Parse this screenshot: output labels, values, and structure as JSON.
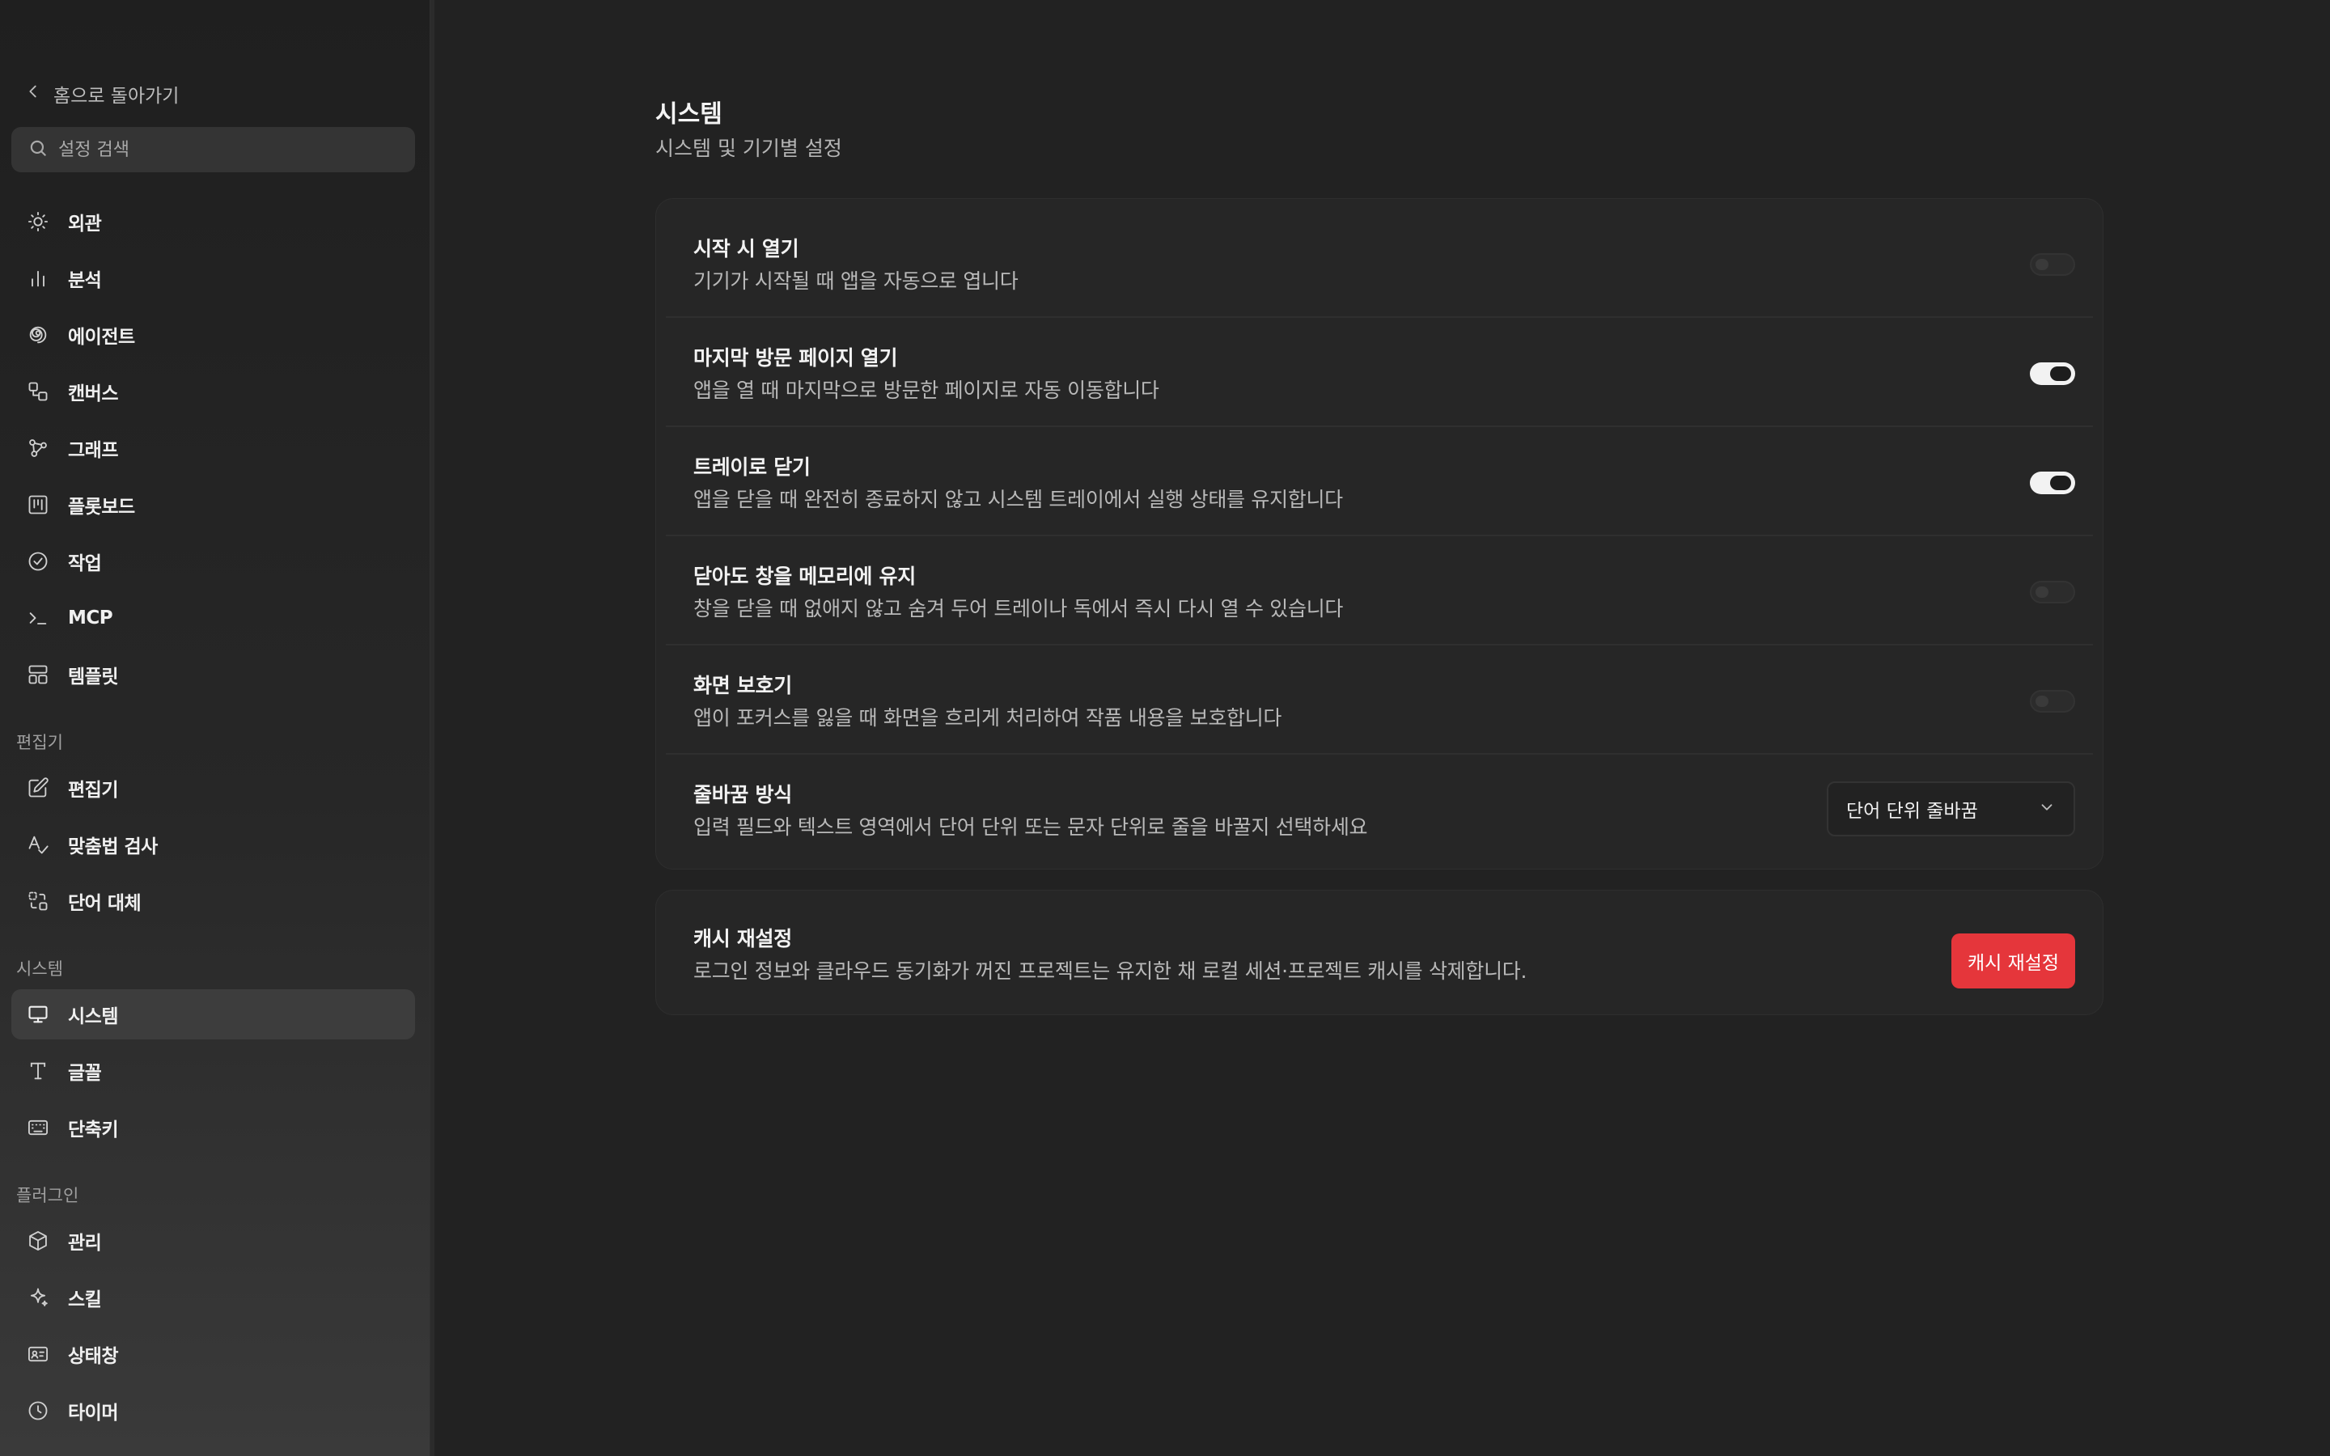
{
  "sidebar": {
    "back_label": "홈으로 돌아가기",
    "search_placeholder": "설정 검색",
    "general_items": [
      {
        "label": "외관",
        "icon": "sun-icon"
      },
      {
        "label": "분석",
        "icon": "bar-chart-icon"
      },
      {
        "label": "에이전트",
        "icon": "spiral-icon"
      },
      {
        "label": "캔버스",
        "icon": "canvas-icon"
      },
      {
        "label": "그래프",
        "icon": "graph-icon"
      },
      {
        "label": "플롯보드",
        "icon": "board-icon"
      },
      {
        "label": "작업",
        "icon": "check-circle-icon"
      },
      {
        "label": "MCP",
        "icon": "terminal-icon"
      },
      {
        "label": "템플릿",
        "icon": "template-icon"
      }
    ],
    "sections": {
      "editor": "편집기",
      "system": "시스템",
      "plugins": "플러그인"
    },
    "editor_items": [
      {
        "label": "편집기",
        "icon": "edit-icon"
      },
      {
        "label": "맞춤법 검사",
        "icon": "spellcheck-icon"
      },
      {
        "label": "단어 대체",
        "icon": "replace-icon"
      }
    ],
    "system_items": [
      {
        "label": "시스템",
        "icon": "monitor-icon",
        "active": true
      },
      {
        "label": "글꼴",
        "icon": "type-icon"
      },
      {
        "label": "단축키",
        "icon": "keyboard-icon"
      }
    ],
    "plugin_items": [
      {
        "label": "관리",
        "icon": "box-icon"
      },
      {
        "label": "스킬",
        "icon": "sparkle-icon"
      },
      {
        "label": "상태창",
        "icon": "id-card-icon"
      },
      {
        "label": "타이머",
        "icon": "clock-icon"
      }
    ]
  },
  "main": {
    "title": "시스템",
    "subtitle": "시스템 및 기기별 설정",
    "settings": [
      {
        "title": "시작 시 열기",
        "desc": "기기가 시작될 때 앱을 자동으로 엽니다",
        "enabled": false
      },
      {
        "title": "마지막 방문 페이지 열기",
        "desc": "앱을 열 때 마지막으로 방문한 페이지로 자동 이동합니다",
        "enabled": true
      },
      {
        "title": "트레이로 닫기",
        "desc": "앱을 닫을 때 완전히 종료하지 않고 시스템 트레이에서 실행 상태를 유지합니다",
        "enabled": true
      },
      {
        "title": "닫아도 창을 메모리에 유지",
        "desc": "창을 닫을 때 없애지 않고 숨겨 두어 트레이나 독에서 즉시 다시 열 수 있습니다",
        "enabled": false
      },
      {
        "title": "화면 보호기",
        "desc": "앱이 포커스를 잃을 때 화면을 흐리게 처리하여 작품 내용을 보호합니다",
        "enabled": false
      }
    ],
    "wrap": {
      "title": "줄바꿈 방식",
      "desc": "입력 필드와 텍스트 영역에서 단어 단위 또는 문자 단위로 줄을 바꿀지 선택하세요",
      "selected": "단어 단위 줄바꿈"
    },
    "cache": {
      "title": "캐시 재설정",
      "desc": "로그인 정보와 클라우드 동기화가 꺼진 프로젝트는 유지한 채 로컬 세션·프로젝트 캐시를 삭제합니다.",
      "button": "캐시 재설정"
    }
  },
  "colors": {
    "danger": "#e5363b",
    "toggle_on": "#f2f2f2",
    "active_nav": "#3d3d3d"
  }
}
